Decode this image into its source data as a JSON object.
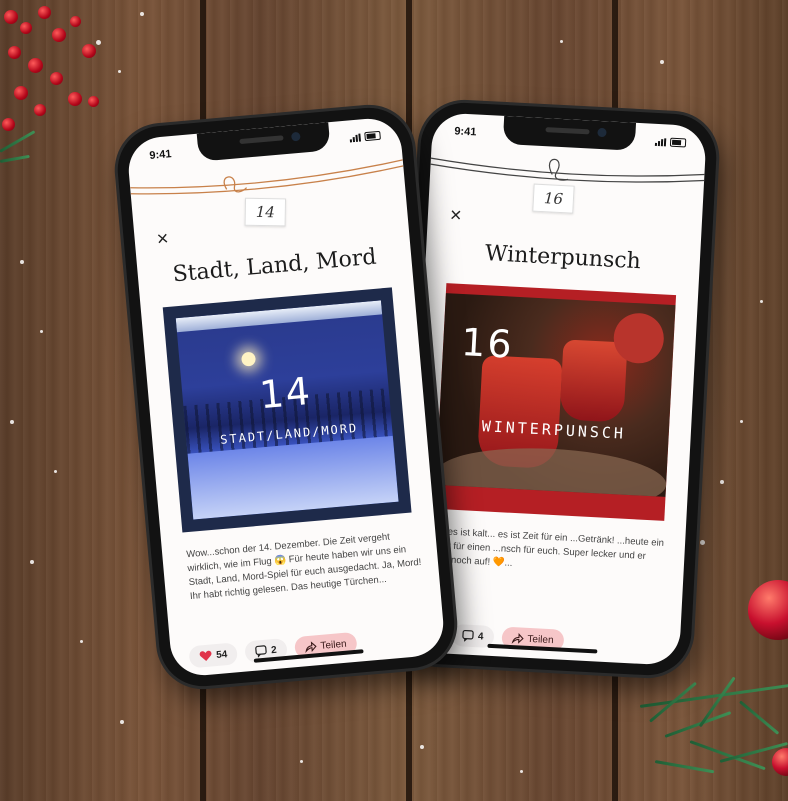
{
  "scene": {
    "background": "wooden table with snow, berries and pine",
    "colors": {
      "accent_pink": "#f6c6c8",
      "heart_red": "#e0334a",
      "wood": "#6b4a32"
    }
  },
  "phones": [
    {
      "status_time": "9:41",
      "day_tag": "14",
      "close_icon": "×",
      "title": "Stadt, Land, Mord",
      "photo_number": "14",
      "photo_caption": "STADT/LAND/MORD",
      "body_text": "Wow...schon der 14. Dezember. Die Zeit vergeht wirklich, wie im Flug 😱 Für heute haben wir uns ein Stadt, Land, Mord-Spiel für euch ausgedacht. Ja, Mord! Ihr habt richtig gelesen. Das heutige Türchen...",
      "likes": "54",
      "comments": "2",
      "share_label": "Teilen"
    },
    {
      "status_time": "9:41",
      "day_tag": "16",
      "close_icon": "×",
      "title": "Winterpunsch",
      "photo_number": "16",
      "photo_caption": "WINTERPUNSCH",
      "body_text": "...tag, es ist kalt... es ist Zeit für ein ...Getränk! ...heute ein Rezept für einen ...nsch für euch. Super lecker und er ...auch noch auf! 🧡...",
      "comments": "4",
      "share_label": "Teilen"
    }
  ]
}
